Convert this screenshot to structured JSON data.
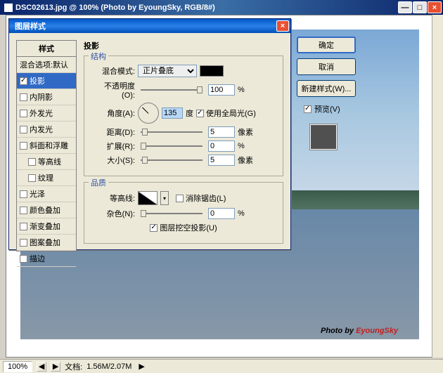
{
  "main_window": {
    "title": "DSC02613.jpg @ 100% (Photo by EyoungSky, RGB/8#)"
  },
  "watermark": {
    "p1": "Photo by ",
    "p2": "EyoungSky"
  },
  "statusbar": {
    "zoom": "100%",
    "docsize_label": "文档:",
    "docsize": "1.56M/2.07M"
  },
  "dialog": {
    "title": "图层样式",
    "styles_header": "样式",
    "styles": {
      "blend": "混合选项:默认",
      "drop_shadow": "投影",
      "inner_shadow": "内阴影",
      "outer_glow": "外发光",
      "inner_glow": "内发光",
      "bevel": "斜面和浮雕",
      "contour": "等高线",
      "texture": "纹理",
      "satin": "光泽",
      "color_overlay": "颜色叠加",
      "gradient_overlay": "渐变叠加",
      "pattern_overlay": "图案叠加",
      "stroke": "描边"
    },
    "panel_title": "投影",
    "group_structure": "结构",
    "group_quality": "品质",
    "blend_mode_label": "混合模式:",
    "blend_mode_value": "正片叠底",
    "opacity_label": "不透明度(O):",
    "opacity_value": "100",
    "angle_label": "角度(A):",
    "angle_value": "135",
    "angle_unit": "度",
    "global_light": "使用全局光(G)",
    "distance_label": "距离(D):",
    "distance_value": "5",
    "spread_label": "扩展(R):",
    "spread_value": "0",
    "size_label": "大小(S):",
    "size_value": "5",
    "px_unit": "像素",
    "pct_unit": "%",
    "contour_label": "等高线:",
    "antialias": "消除锯齿(L)",
    "noise_label": "杂色(N):",
    "noise_value": "0",
    "knockout": "图层挖空投影(U)"
  },
  "buttons": {
    "ok": "确定",
    "cancel": "取消",
    "new_style": "新建样式(W)...",
    "preview": "预览(V)"
  }
}
